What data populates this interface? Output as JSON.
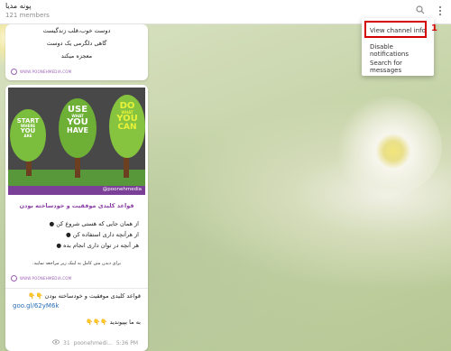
{
  "header": {
    "title": "پونه مدیا",
    "members": "121 members"
  },
  "colors": {
    "accent_red": "#d40000",
    "brand_purple": "#9a5fb3",
    "link_blue": "#2a6fb5"
  },
  "message1": {
    "lines": [
      "دوست خوب،قلب زندگیست",
      "گاهی دلگرمی یک دوست",
      "معجزه میکند"
    ],
    "logo_text": "WWW.POONEHMEDIA.COM"
  },
  "message2": {
    "poster": {
      "tree1": [
        "START",
        "WHERE",
        "YOU",
        "ARE"
      ],
      "tree2": [
        "USE",
        "WHAT",
        "YOU",
        "HAVE"
      ],
      "tree3": [
        "DO",
        "WHAT",
        "YOU",
        "CAN"
      ],
      "handle": "@poonehmedia"
    },
    "caption_title": "قواعد کلیدی موفقیت و خودساخته بودن",
    "bullets": [
      "از همان جایی که هستی شروع کن ●",
      "از هرآنچه داری استفاده کن ●",
      "هر آنچه در توان داری انجام بده ●"
    ],
    "note": "برای دیدن متن کامل به لینک زیر مراجعه نمایید.",
    "logo_text": "WWW.POONEHMEDIA.COM",
    "text_line": "قواعد کلیدی موفقیت و خودساخته بودن 👇👇",
    "link": "goo.gl/62yM6k",
    "join_line": "به ما بپیوندید 👇👇👇",
    "views": "31",
    "author": "poonehmedi...",
    "time": "5:36 PM"
  },
  "menu": {
    "items": [
      "View channel info",
      "Disable notifications",
      "Search for messages"
    ]
  },
  "annotation": {
    "step": "1"
  }
}
